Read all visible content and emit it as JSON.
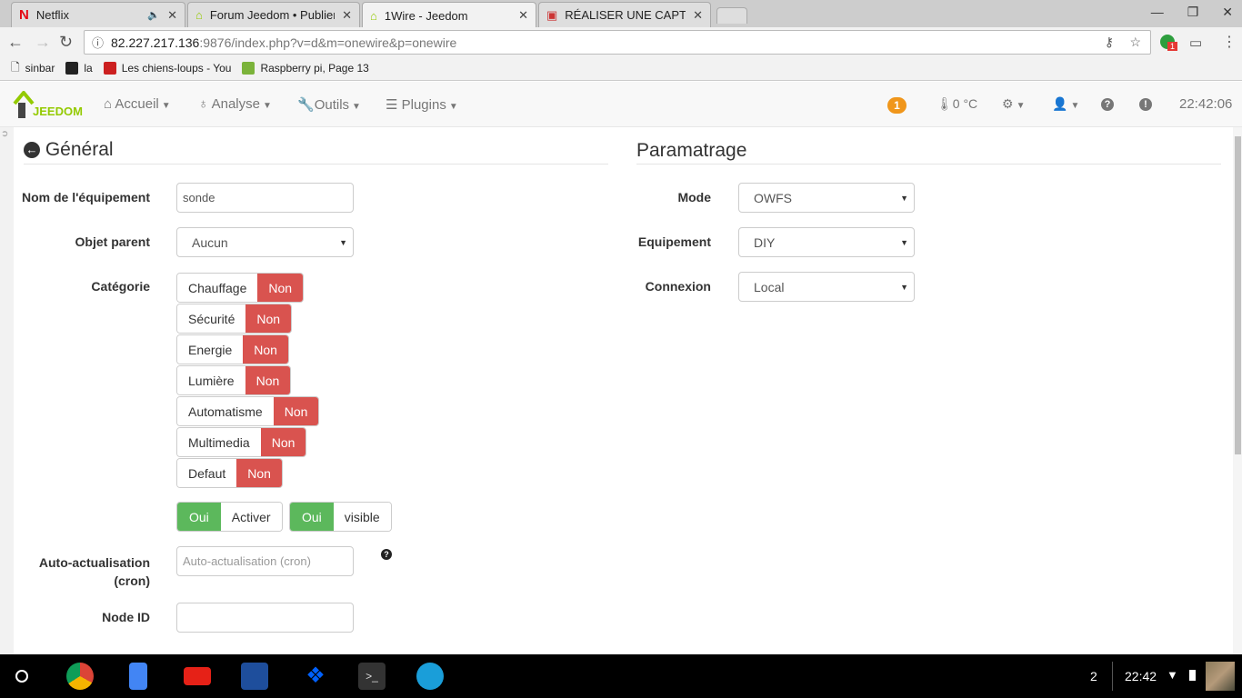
{
  "browser": {
    "tabs": [
      {
        "title": "Netflix",
        "audio": true
      },
      {
        "title": "Forum Jeedom • Publier"
      },
      {
        "title": "1Wire - Jeedom",
        "active": true
      },
      {
        "title": "RÉALISER UNE CAPTURE"
      }
    ],
    "url_host": "82.227.217.136",
    "url_path": ":9876/index.php?v=d&m=onewire&p=onewire",
    "extension_badge": "1",
    "bookmarks": [
      "sinbar",
      "la",
      "Les chiens-loups - You",
      "Raspberry pi, Page 13"
    ]
  },
  "nav": {
    "logo": "JEEDOM",
    "menus": [
      "Accueil",
      "Analyse",
      "Outils",
      "Plugins"
    ],
    "notification_count": "1",
    "temperature": "0 °C",
    "time": "22:42:06"
  },
  "general": {
    "title": "Général",
    "name_label": "Nom de l'équipement",
    "name_value": "sonde",
    "parent_label": "Objet parent",
    "parent_value": "Aucun",
    "category_label": "Catégorie",
    "categories": [
      {
        "name": "Chauffage",
        "state": "Non"
      },
      {
        "name": "Sécurité",
        "state": "Non"
      },
      {
        "name": "Energie",
        "state": "Non"
      },
      {
        "name": "Lumière",
        "state": "Non"
      },
      {
        "name": "Automatisme",
        "state": "Non"
      },
      {
        "name": "Multimedia",
        "state": "Non"
      },
      {
        "name": "Defaut",
        "state": "Non"
      }
    ],
    "activate_state": "Oui",
    "activate_label": "Activer",
    "visible_state": "Oui",
    "visible_label": "visible",
    "cron_label": "Auto-actualisation (cron)",
    "cron_placeholder": "Auto-actualisation (cron)",
    "node_label": "Node ID",
    "node_value": ""
  },
  "settings": {
    "title": "Paramatrage",
    "fields": [
      {
        "label": "Mode",
        "value": "OWFS"
      },
      {
        "label": "Equipement",
        "value": "DIY"
      },
      {
        "label": "Connexion",
        "value": "Local"
      }
    ]
  },
  "taskbar": {
    "badge": "2",
    "time": "22:42"
  },
  "colors": {
    "danger": "#d9534f",
    "success": "#5cb85c",
    "warning": "#f0961b",
    "jeedom_green": "#94ca02"
  }
}
